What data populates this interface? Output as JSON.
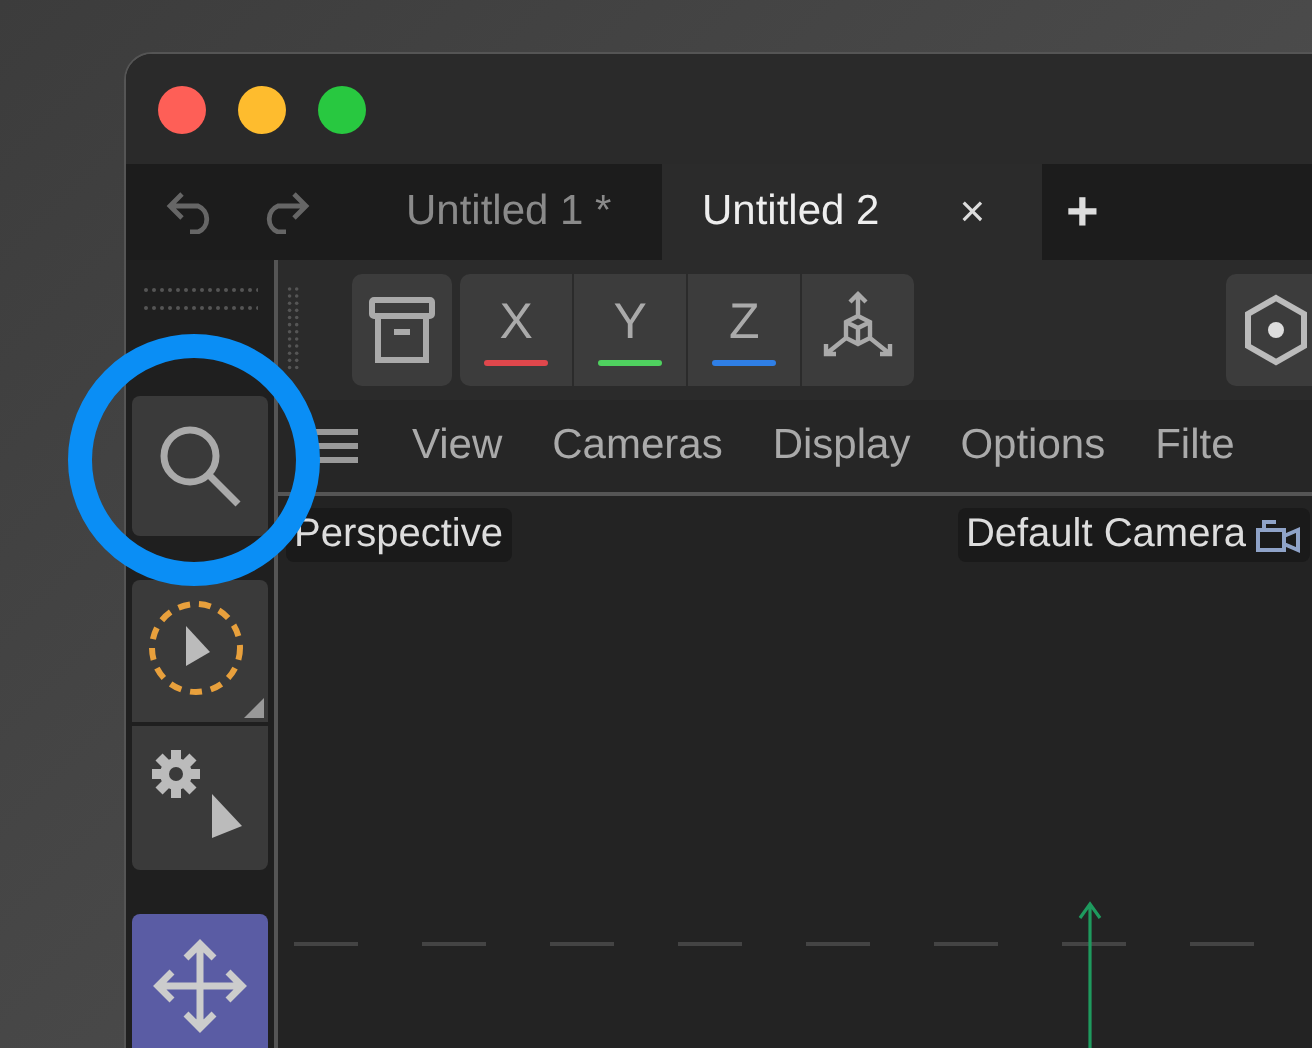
{
  "tabs": [
    {
      "label": "Untitled 1 *",
      "selected": false
    },
    {
      "label": "Untitled 2",
      "selected": true,
      "close": "×"
    }
  ],
  "new_tab": "+",
  "axis_buttons": [
    {
      "label": "X",
      "color": "#e0474c"
    },
    {
      "label": "Y",
      "color": "#4fd15f"
    },
    {
      "label": "Z",
      "color": "#2f7fe6"
    }
  ],
  "tools": [
    {
      "kind": "search",
      "selected": false
    },
    {
      "kind": "select",
      "selected": false
    },
    {
      "kind": "gear",
      "selected": false
    },
    {
      "kind": "move",
      "selected": true
    }
  ],
  "viewport_menu": [
    "View",
    "Cameras",
    "Display",
    "Options",
    "Filte"
  ],
  "viewport": {
    "projection": "Perspective",
    "camera": "Default Camera"
  }
}
